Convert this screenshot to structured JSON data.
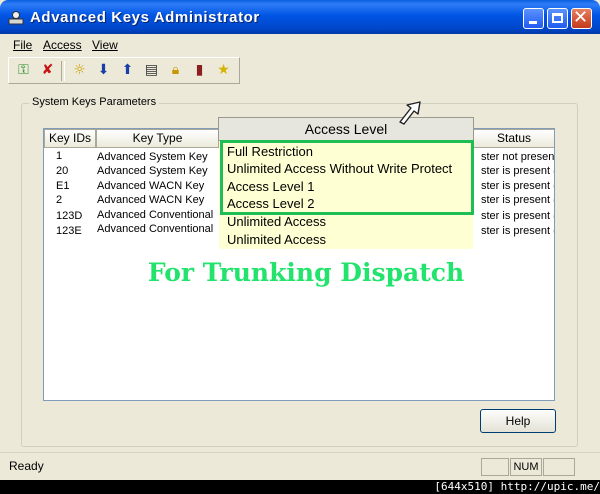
{
  "window": {
    "title": "Advanced Keys Administrator"
  },
  "menu": {
    "file": "File",
    "access": "Access",
    "view": "View"
  },
  "toolbar": {
    "icons": [
      "key-icon",
      "delete-key-icon",
      "settings-icon",
      "download-icon",
      "upload-icon",
      "document-icon",
      "lock-icon",
      "exit-door-icon",
      "star-icon"
    ]
  },
  "group": {
    "label": "System Keys Parameters"
  },
  "list": {
    "columns": [
      "Key IDs",
      "Key Type",
      "Status"
    ],
    "rows": [
      {
        "id": "1",
        "type": "Advanced System Key",
        "status": "ster not present"
      },
      {
        "id": "20",
        "type": "Advanced System Key",
        "status": "ster is present (e"
      },
      {
        "id": "E1",
        "type": "Advanced WACN Key",
        "status": "ster is present (e"
      },
      {
        "id": "2",
        "type": "Advanced WACN Key",
        "status": "ster is present (e"
      },
      {
        "id": "123D",
        "type": "Advanced Conventional",
        "status": "ster is present (e"
      },
      {
        "id": "123E",
        "type": "Advanced Conventional",
        "status": "ster is present (e"
      }
    ]
  },
  "access_dropdown": {
    "header": "Access Level",
    "options": [
      "Full Restriction",
      "Unlimited Access Without Write Protect",
      "Access Level 1",
      "Access Level 2",
      "Unlimited Access",
      "Unlimited Access"
    ],
    "highlight_color": "#1fbe55"
  },
  "overlay_caption": "For Trunking Dispatch",
  "buttons": {
    "help": "Help"
  },
  "statusbar": {
    "text": "Ready",
    "num": "NUM"
  },
  "watermark": "[644x510] http://upic.me/"
}
